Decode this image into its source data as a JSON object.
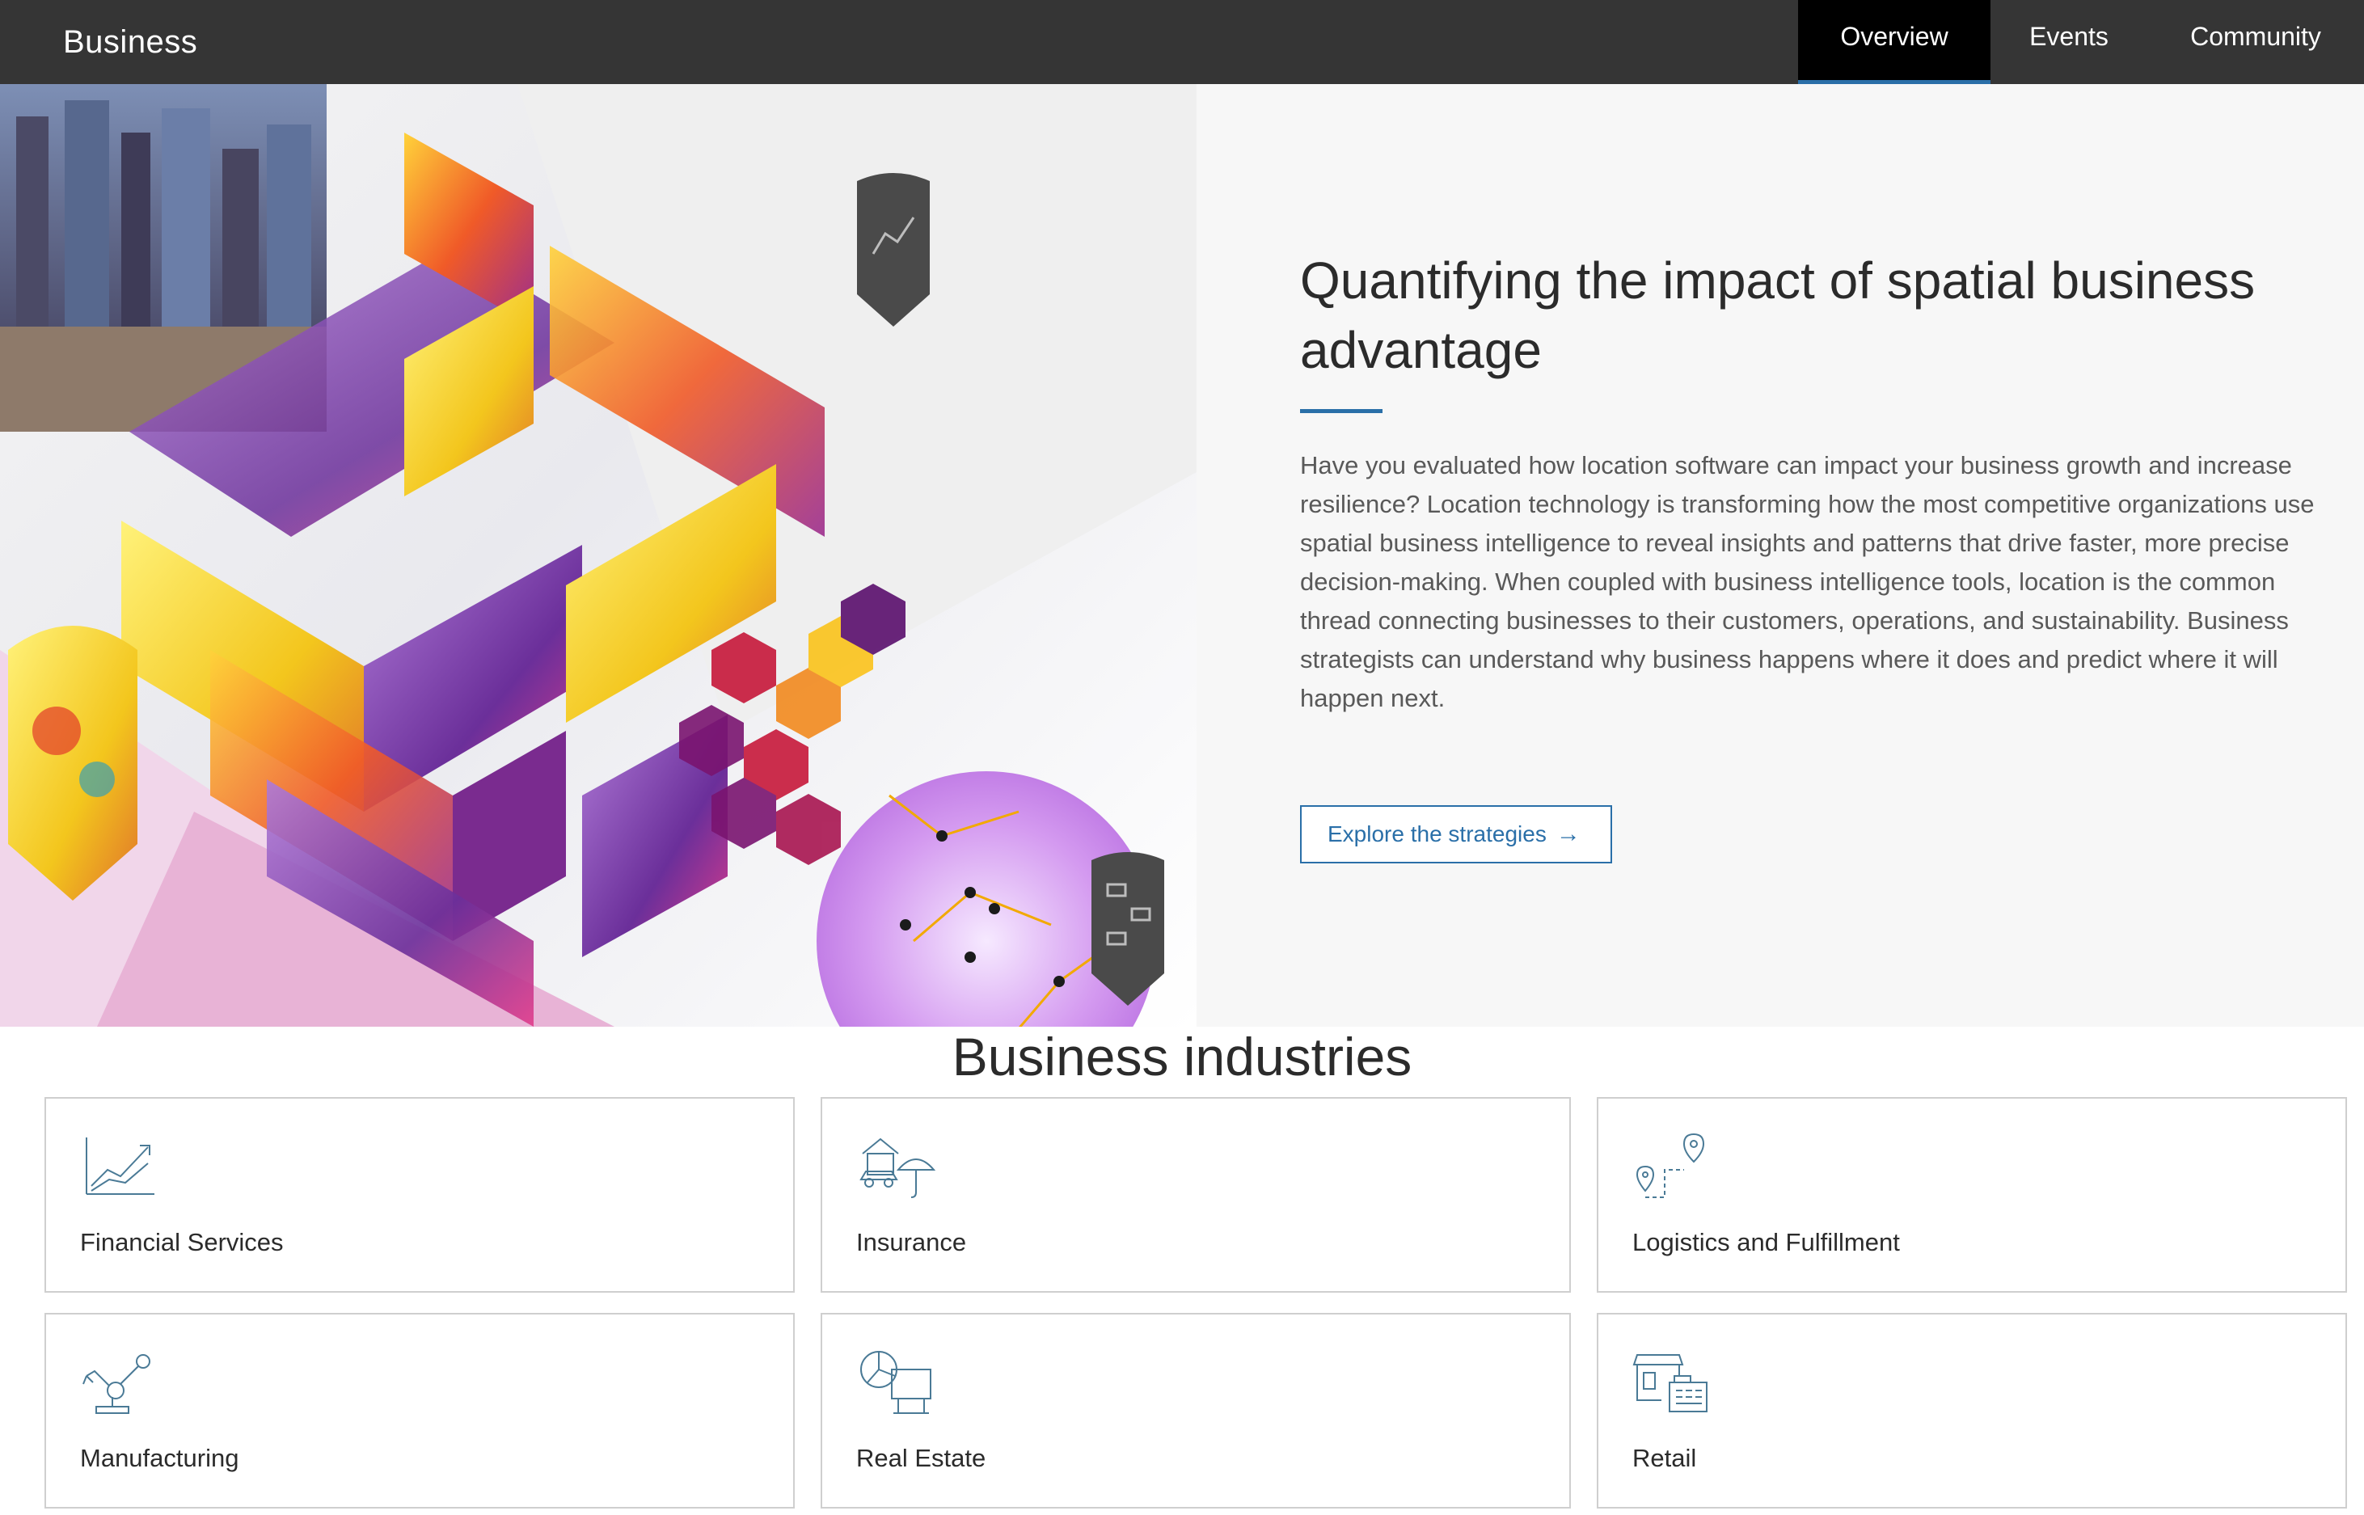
{
  "nav": {
    "brand": "Business",
    "tabs": [
      {
        "label": "Overview",
        "active": true
      },
      {
        "label": "Events",
        "active": false
      },
      {
        "label": "Community",
        "active": false
      }
    ]
  },
  "hero": {
    "title": "Quantifying the impact of spatial business advantage",
    "body": "Have you evaluated how location software can impact your business growth and increase resilience? Location technology is transforming how the most competitive organizations use spatial business intelligence to reveal insights and patterns that drive faster, more precise decision-making. When coupled with business intelligence tools, location is the common thread connecting businesses to their customers, operations, and sustainability. Business strategists can understand why business happens where it does and predict where it will happen next.",
    "cta_label": "Explore the strategies",
    "cta_icon": "arrow-right-icon"
  },
  "industries": {
    "title": "Business industries",
    "items": [
      {
        "label": "Financial Services",
        "icon": "line-chart-icon"
      },
      {
        "label": "Insurance",
        "icon": "house-car-umbrella-icon"
      },
      {
        "label": "Logistics and Fulfillment",
        "icon": "route-pins-icon"
      },
      {
        "label": "Manufacturing",
        "icon": "robotic-arm-icon"
      },
      {
        "label": "Real Estate",
        "icon": "pie-chart-board-icon"
      },
      {
        "label": "Retail",
        "icon": "storefront-register-icon"
      }
    ]
  },
  "colors": {
    "nav_bg": "#353535",
    "active_tab_bg": "#000000",
    "accent": "#2a6fa8",
    "panel_bg": "#f7f7f7"
  }
}
